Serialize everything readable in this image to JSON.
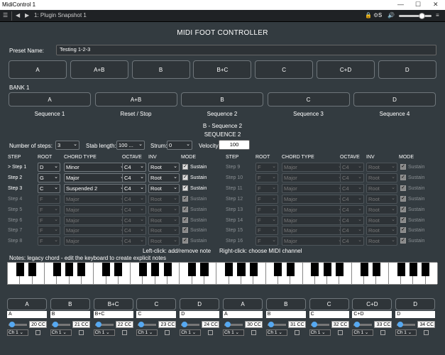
{
  "window": {
    "title": "MidiControl 1",
    "snapshot": "1: Plugin Snapshot 1",
    "s_label": "S"
  },
  "header": {
    "title": "MIDI FOOT CONTROLLER"
  },
  "preset": {
    "label": "Preset Name:",
    "value": "Testing 1-2-3"
  },
  "top_buttons": [
    "A",
    "A+B",
    "B",
    "B+C",
    "C",
    "C+D",
    "D"
  ],
  "bank": {
    "label": "BANK 1",
    "buttons": [
      "A",
      "A+B",
      "B",
      "C",
      "D"
    ],
    "actions": [
      "Sequence 1",
      "Reset / Stop",
      "Sequence 2",
      "Sequence 3",
      "Sequence 4"
    ]
  },
  "sequence": {
    "subtitle": "B  -  Sequence 2",
    "title": "SEQUENCE 2",
    "num_steps_label": "Number of steps:",
    "num_steps": "3",
    "stab_label": "Stab length:",
    "stab": "100 ...",
    "strum_label": "Strum:",
    "strum": "0",
    "velocity_label": "Velocity:",
    "velocity": "100"
  },
  "columns": {
    "step": "STEP",
    "root": "ROOT",
    "chord": "CHORD TYPE",
    "octave": "OCTAVE",
    "inv": "INV",
    "mode": "MODE"
  },
  "steps_left": [
    {
      "step": "> Step 1",
      "root": "D",
      "chord": "Minor",
      "octave": "C4",
      "inv": "Root",
      "mode": "Sustain",
      "active": true
    },
    {
      "step": "Step 2",
      "root": "G",
      "chord": "Major",
      "octave": "C4",
      "inv": "Root",
      "mode": "Sustain",
      "active": true
    },
    {
      "step": "Step 3",
      "root": "C",
      "chord": "Suspended 2",
      "octave": "C4",
      "inv": "Root",
      "mode": "Sustain",
      "active": true
    },
    {
      "step": "Step 4",
      "root": "F",
      "chord": "Major",
      "octave": "C4",
      "inv": "Root",
      "mode": "Sustain",
      "active": false
    },
    {
      "step": "Step 5",
      "root": "F",
      "chord": "Major",
      "octave": "C4",
      "inv": "Root",
      "mode": "Sustain",
      "active": false
    },
    {
      "step": "Step 6",
      "root": "F",
      "chord": "Major",
      "octave": "C4",
      "inv": "Root",
      "mode": "Sustain",
      "active": false
    },
    {
      "step": "Step 7",
      "root": "F",
      "chord": "Major",
      "octave": "C4",
      "inv": "Root",
      "mode": "Sustain",
      "active": false
    },
    {
      "step": "Step 8",
      "root": "F",
      "chord": "Major",
      "octave": "C4",
      "inv": "Root",
      "mode": "Sustain",
      "active": false
    }
  ],
  "steps_right": [
    {
      "step": "Step 9",
      "root": "F",
      "chord": "Major",
      "octave": "C4",
      "inv": "Root",
      "mode": "Sustain"
    },
    {
      "step": "Step 10",
      "root": "F",
      "chord": "Major",
      "octave": "C4",
      "inv": "Root",
      "mode": "Sustain"
    },
    {
      "step": "Step 11",
      "root": "F",
      "chord": "Major",
      "octave": "C4",
      "inv": "Root",
      "mode": "Sustain"
    },
    {
      "step": "Step 12",
      "root": "F",
      "chord": "Major",
      "octave": "C4",
      "inv": "Root",
      "mode": "Sustain"
    },
    {
      "step": "Step 13",
      "root": "F",
      "chord": "Major",
      "octave": "C4",
      "inv": "Root",
      "mode": "Sustain"
    },
    {
      "step": "Step 14",
      "root": "F",
      "chord": "Major",
      "octave": "C4",
      "inv": "Root",
      "mode": "Sustain"
    },
    {
      "step": "Step 15",
      "root": "F",
      "chord": "Major",
      "octave": "C4",
      "inv": "Root",
      "mode": "Sustain"
    },
    {
      "step": "Step 16",
      "root": "F",
      "chord": "Major",
      "octave": "C4",
      "inv": "Root",
      "mode": "Sustain"
    }
  ],
  "hints": {
    "left_click": "Left-click: add/remove note",
    "right_click": "Right-click: choose MIDI channel",
    "notes": "Notes: legacy chord - edit the keyboard to create explicit notes"
  },
  "footswitches": [
    {
      "label": "A",
      "name": "A",
      "cc": "20 CC",
      "ch": "Ch 1"
    },
    {
      "label": "B",
      "name": "B",
      "cc": "21 CC",
      "ch": "Ch 1"
    },
    {
      "label": "B+C",
      "name": "B+C",
      "cc": "22 CC",
      "ch": "Ch 1"
    },
    {
      "label": "C",
      "name": "C",
      "cc": "23 CC",
      "ch": "Ch 1"
    },
    {
      "label": "D",
      "name": "D",
      "cc": "24 CC",
      "ch": "Ch 1"
    },
    {
      "label": "A",
      "name": "A",
      "cc": "30 CC",
      "ch": "Ch 1"
    },
    {
      "label": "B",
      "name": "B",
      "cc": "31 CC",
      "ch": "Ch 1"
    },
    {
      "label": "C",
      "name": "C",
      "cc": "32 CC",
      "ch": "Ch 1"
    },
    {
      "label": "C+D",
      "name": "C+D",
      "cc": "33 CC",
      "ch": "Ch 1"
    },
    {
      "label": "D",
      "name": "D",
      "cc": "34 CC",
      "ch": "Ch 1"
    }
  ],
  "colors": {
    "bg": "#333b40",
    "accent": "#56a9f2"
  }
}
